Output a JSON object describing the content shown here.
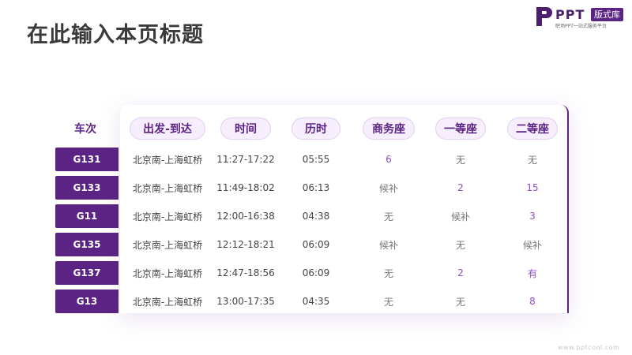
{
  "page_title": "在此输入本页标题",
  "logo": {
    "name": "PPT",
    "badge": "版式库",
    "tagline": "职场PPT一站式服务平台"
  },
  "table": {
    "first_header": "车次",
    "headers": [
      "出发-到达",
      "时间",
      "历时",
      "商务座",
      "一等座",
      "二等座"
    ],
    "rows": [
      {
        "train": "G131",
        "route": "北京南-上海虹桥",
        "time": "11:27-17:22",
        "duration": "05:55",
        "business": "6",
        "first": "无",
        "second": "无"
      },
      {
        "train": "G133",
        "route": "北京南-上海虹桥",
        "time": "11:49-18:02",
        "duration": "06:13",
        "business": "候补",
        "first": "2",
        "second": "15"
      },
      {
        "train": "G11",
        "route": "北京南-上海虹桥",
        "time": "12:00-16:38",
        "duration": "04:38",
        "business": "无",
        "first": "候补",
        "second": "3"
      },
      {
        "train": "G135",
        "route": "北京南-上海虹桥",
        "time": "12:12-18:21",
        "duration": "06:09",
        "business": "候补",
        "first": "无",
        "second": "候补"
      },
      {
        "train": "G137",
        "route": "北京南-上海虹桥",
        "time": "12:47-18:56",
        "duration": "06:09",
        "business": "无",
        "first": "2",
        "second": "有"
      },
      {
        "train": "G13",
        "route": "北京南-上海虹桥",
        "time": "13:00-17:35",
        "duration": "04:35",
        "business": "无",
        "first": "无",
        "second": "8"
      }
    ]
  },
  "watermark": "www.pptcool.com",
  "colors": {
    "accent": "#5b2384",
    "accent_light": "#f6eefc",
    "value_purple": "#8e4fc4"
  }
}
